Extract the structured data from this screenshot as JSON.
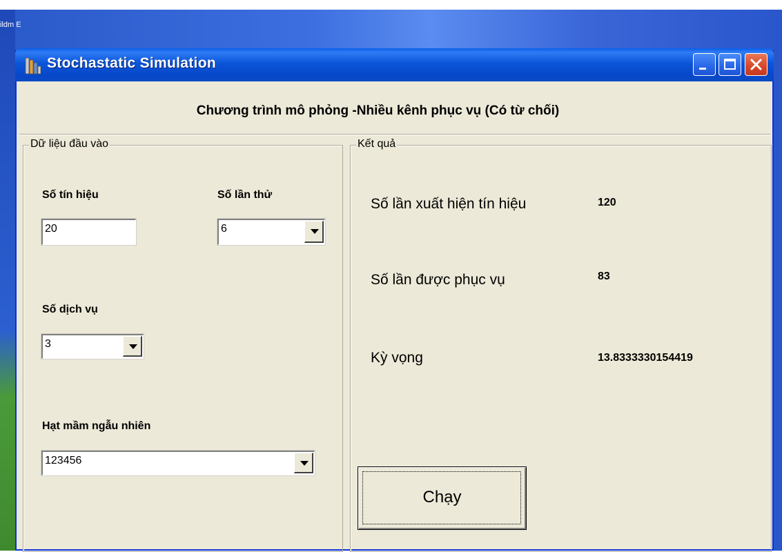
{
  "desktop": {
    "side_text": "ildm E"
  },
  "window": {
    "title": "Stochastatic Simulation",
    "heading": "Chương trình mô phỏng -Nhiều kênh phục vụ (Có từ chối)"
  },
  "input_group": {
    "legend": "Dữ liệu đầu vào",
    "signals_label": "Số tín hiệu",
    "signals_value": "20",
    "trials_label": "Số lần thử",
    "trials_value": "6",
    "services_label": "Số dịch vụ",
    "services_value": "3",
    "seed_label": "Hạt mầm ngẫu nhiên",
    "seed_value": "123456"
  },
  "result_group": {
    "legend": "Kết quả",
    "appear_label": "Số lần xuất hiện tín hiệu",
    "appear_value": "120",
    "served_label": "Số lần được phục vụ",
    "served_value": "83",
    "expect_label": "Kỳ vọng",
    "expect_value": "13.8333330154419"
  },
  "buttons": {
    "run_label": "Chạy"
  },
  "colors": {
    "titlebar": "#0b55d9",
    "window_bg": "#ece9d8",
    "close": "#d8452a"
  }
}
